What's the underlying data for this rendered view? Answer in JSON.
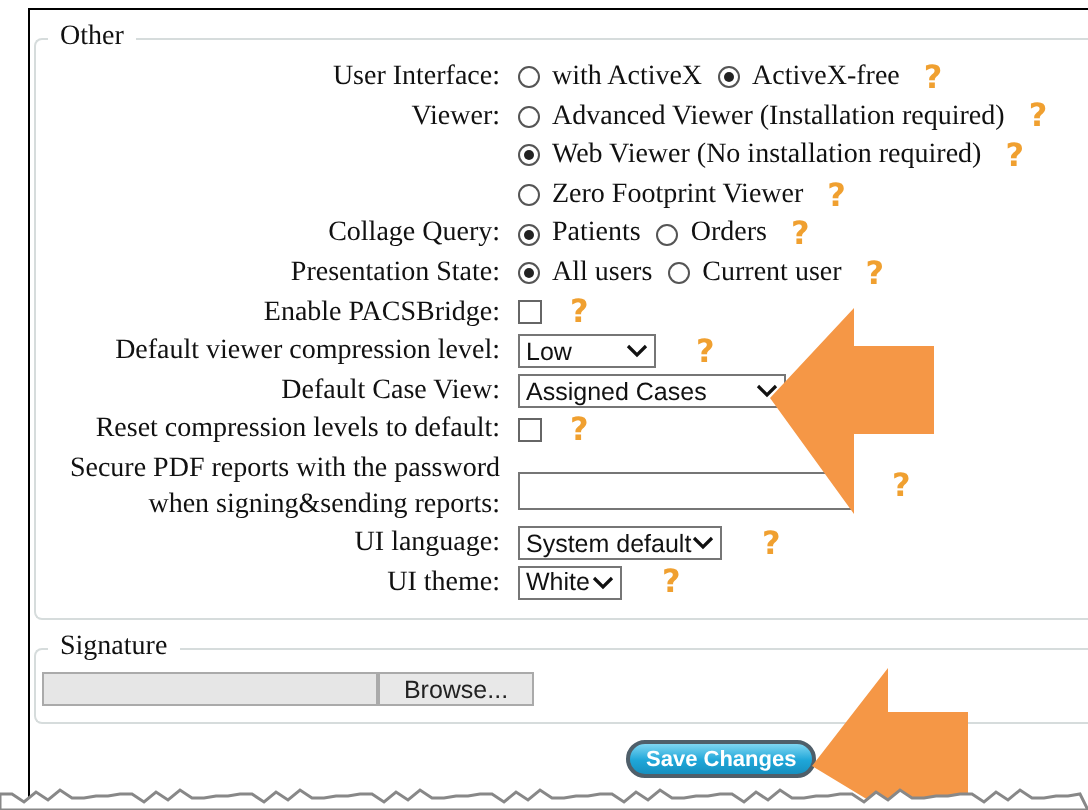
{
  "other": {
    "legend": "Other",
    "rows": [
      {
        "kind": "radio",
        "label": "User Interface:",
        "options": [
          {
            "label": "with ActiveX",
            "selected": false
          },
          {
            "label": "ActiveX-free",
            "selected": true,
            "help": "?"
          }
        ]
      },
      {
        "kind": "radio_stack",
        "label": "Viewer:",
        "options": [
          {
            "label": "Advanced Viewer (Installation required)",
            "selected": false,
            "help": "?"
          },
          {
            "label": "Web Viewer (No installation required)",
            "selected": true,
            "help": "?"
          },
          {
            "label": "Zero Footprint Viewer",
            "selected": false,
            "help": "?"
          }
        ]
      },
      {
        "kind": "radio",
        "label": "Collage Query:",
        "options": [
          {
            "label": "Patients",
            "selected": true
          },
          {
            "label": "Orders",
            "selected": false,
            "help": "?"
          }
        ]
      },
      {
        "kind": "radio",
        "label": "Presentation State:",
        "options": [
          {
            "label": "All users",
            "selected": true
          },
          {
            "label": "Current user",
            "selected": false,
            "help": "?"
          }
        ]
      },
      {
        "kind": "checkbox",
        "label": "Enable PACSBridge:",
        "checked": false,
        "help": "?"
      },
      {
        "kind": "select",
        "label": "Default viewer compression level:",
        "value": "Low",
        "help": "?"
      },
      {
        "kind": "select",
        "label": "Default Case View:",
        "value": "Assigned Cases"
      },
      {
        "kind": "checkbox",
        "label": "Reset compression levels to default:",
        "checked": false,
        "help": "?"
      },
      {
        "kind": "text",
        "label": "Secure PDF reports with the password when signing&sending reports:",
        "help": "?"
      },
      {
        "kind": "select",
        "label": "UI language:",
        "value": "System default",
        "help": "?"
      },
      {
        "kind": "select",
        "label": "UI theme:",
        "value": "White",
        "help": "?"
      }
    ]
  },
  "signature": {
    "legend": "Signature",
    "button": "Browse..."
  },
  "save_button": "Save Changes"
}
